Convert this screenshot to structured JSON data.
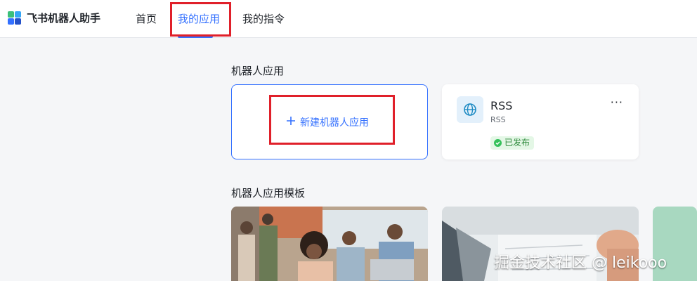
{
  "header": {
    "brand": "飞书机器人助手",
    "nav": [
      "首页",
      "我的应用",
      "我的指令"
    ]
  },
  "apps": {
    "title": "机器人应用",
    "new_label": "新建机器人应用",
    "items": [
      {
        "name": "RSS",
        "subtitle": "RSS",
        "status": "已发布"
      }
    ]
  },
  "templates": {
    "title": "机器人应用模板"
  },
  "watermark": "掘金技术社区 @ leikooo",
  "colors": {
    "accent": "#3370ff",
    "highlight": "#e0202a",
    "published": "#34c15a"
  }
}
